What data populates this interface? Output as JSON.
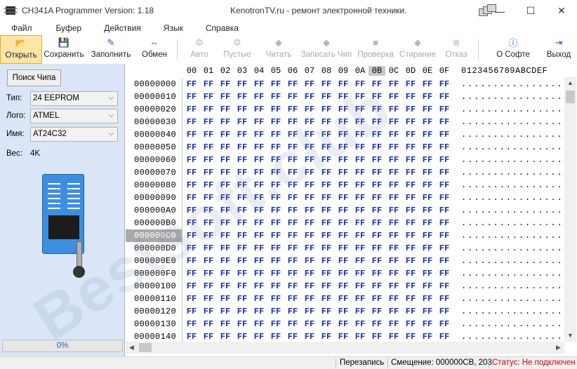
{
  "window": {
    "app_title": "CH341A Programmer Version: 1.18",
    "center_title": "KenotronTV.ru - ремонт электронной техники.",
    "minimize_glyph": "—",
    "maximize_glyph": "☐",
    "close_glyph": "✕"
  },
  "menu": [
    {
      "label": "Файл"
    },
    {
      "label": "Буфер"
    },
    {
      "label": "Действия"
    },
    {
      "label": "Язык"
    },
    {
      "label": "Справка"
    }
  ],
  "toolbar": [
    {
      "label": "Открыть",
      "icon": "folder-open-icon",
      "glyph": "📂",
      "enabled": true,
      "active": true
    },
    {
      "label": "Сохранить",
      "icon": "floppy-disk-icon",
      "glyph": "💾",
      "enabled": true,
      "active": false
    },
    {
      "label": "Заполнить",
      "icon": "fill-icon",
      "glyph": "✎",
      "enabled": true,
      "active": false
    },
    {
      "label": "Обмен",
      "icon": "swap-arrows-icon",
      "glyph": "⇔",
      "enabled": true,
      "active": false
    },
    {
      "label": "Авто",
      "icon": "gear-icon",
      "glyph": "⚙",
      "enabled": false,
      "active": false
    },
    {
      "label": "Пустые",
      "icon": "gear-icon",
      "glyph": "⚙",
      "enabled": false,
      "active": false
    },
    {
      "label": "Читать",
      "icon": "chip-read-icon",
      "glyph": "◆",
      "enabled": false,
      "active": false
    },
    {
      "label": "Записать Чип",
      "icon": "chip-write-icon",
      "glyph": "◆",
      "enabled": false,
      "active": false
    },
    {
      "label": "Проверка",
      "icon": "verify-icon",
      "glyph": "■",
      "enabled": false,
      "active": false
    },
    {
      "label": "Стирание",
      "icon": "eraser-icon",
      "glyph": "◆",
      "enabled": false,
      "active": false
    },
    {
      "label": "Отказ",
      "icon": "cancel-icon",
      "glyph": "⊗",
      "enabled": false,
      "active": false
    },
    {
      "label": "О Софте",
      "icon": "info-icon",
      "glyph": "ⓘ",
      "enabled": true,
      "active": false
    },
    {
      "label": "Выход",
      "icon": "exit-door-icon",
      "glyph": "⇥",
      "enabled": true,
      "active": false
    }
  ],
  "chip_panel": {
    "search_button": "Поиск Чипа",
    "type_label": "Тип:",
    "type_value": "24 EEPROM",
    "vendor_label": "Лого:",
    "vendor_value": "ATMEL",
    "name_label": "Имя:",
    "name_value": "AT24C32",
    "size_label": "Вес:",
    "size_value": "4K",
    "progress_text": "0%",
    "progress_value": 0,
    "dropdown_glyph": "⌵"
  },
  "hex": {
    "columns": [
      "00",
      "01",
      "02",
      "03",
      "04",
      "05",
      "06",
      "07",
      "08",
      "09",
      "0A",
      "0B",
      "0C",
      "0D",
      "0E",
      "0F"
    ],
    "selected_column": 11,
    "ascii_header": "0123456789ABCDEF",
    "byte_value": "FF",
    "ascii_row": "................",
    "selected_row": 12,
    "rows": [
      "00000000",
      "00000010",
      "00000020",
      "00000030",
      "00000040",
      "00000050",
      "00000060",
      "00000070",
      "00000080",
      "00000090",
      "000000A0",
      "000000B0",
      "000000C0",
      "000000D0",
      "000000E0",
      "000000F0",
      "00000100",
      "00000110",
      "00000120",
      "00000130",
      "00000140"
    ]
  },
  "status": {
    "mode": "Перезапись",
    "offset": "Смещение: 000000CB, 203",
    "state": "Статус: Не подключен",
    "state_color": "#d0021b"
  },
  "watermark": "Bestsoft.club",
  "colors": {
    "accent": "#3d8ee0",
    "hex_byte": "#1b2fa8",
    "panel_bg": "#dae6f7",
    "active_button": "#ffe6a8"
  }
}
